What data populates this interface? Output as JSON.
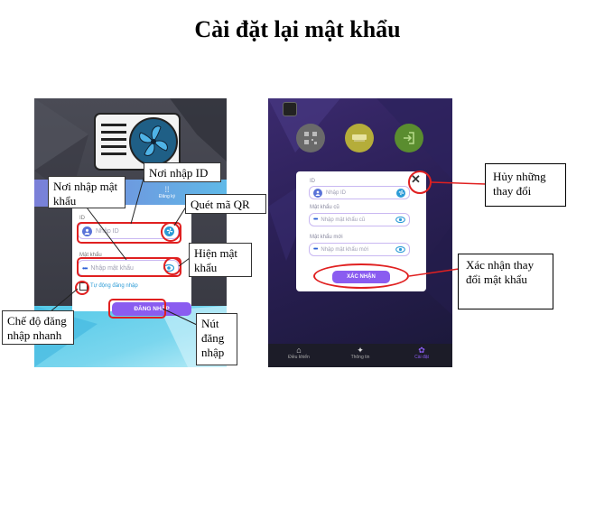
{
  "title": "Cài đặt lại mật khẩu",
  "login_screen": {
    "register_label": "Đăng ký",
    "id_label": "ID",
    "id_placeholder": "Nhập ID",
    "password_label": "Mật khẩu",
    "password_placeholder": "Nhập mật khẩu",
    "quick_login_label": "Tự động đăng nhập",
    "login_button": "ĐĂNG NHẬP"
  },
  "reset_screen": {
    "id_label": "ID",
    "id_placeholder": "Nhập ID",
    "old_password_label": "Mật khẩu cũ",
    "old_password_placeholder": "Nhập mật khẩu cũ",
    "new_password_label": "Mật khẩu mới",
    "new_password_placeholder": "Nhập mật khẩu mới",
    "confirm_button": "XÁC NHẬN",
    "nav": [
      "Điều khiển",
      "Thông tin",
      "Cài đặt"
    ]
  },
  "callouts": {
    "id_input": "Nơi nhập ID",
    "password_input": "Nơi nhập mật khẩu",
    "qr_scan": "Quét mã QR",
    "show_password": "Hiện mật khẩu",
    "quick_login": "Chế độ đăng nhập nhanh",
    "login_button": "Nút đăng nhập",
    "cancel_changes": "Hủy những thay đổi",
    "confirm_change": "Xác nhận thay đổi mật khẩu"
  },
  "colors": {
    "accent": "#8a5cf0",
    "teal": "#2b9bd6",
    "red": "#e02020"
  }
}
